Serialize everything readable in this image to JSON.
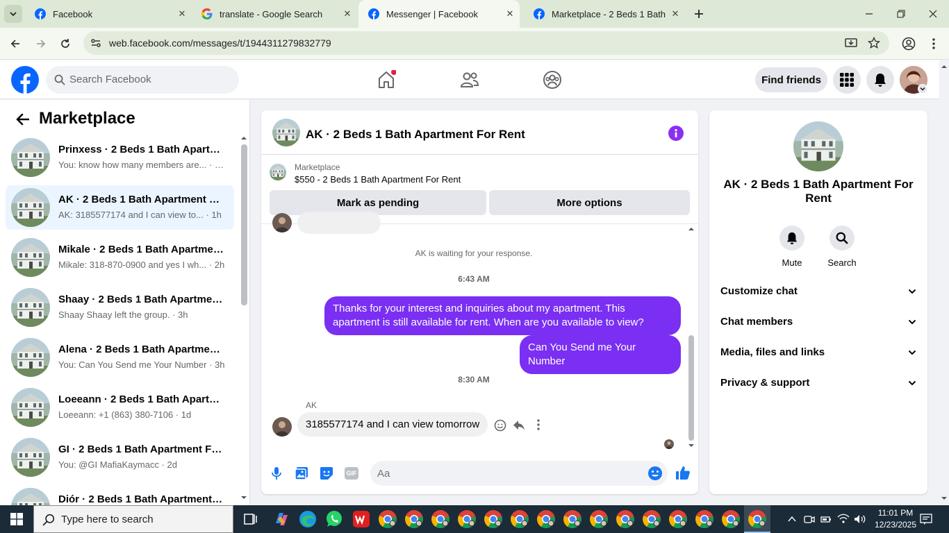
{
  "browser": {
    "tabs": [
      {
        "title": "Facebook",
        "icon": "facebook-icon",
        "active": false
      },
      {
        "title": "translate - Google Search",
        "icon": "google-icon",
        "active": false
      },
      {
        "title": "Messenger | Facebook",
        "icon": "facebook-icon",
        "active": true
      },
      {
        "title": "Marketplace - 2 Beds 1 Bath Ap",
        "icon": "facebook-icon",
        "active": false
      }
    ],
    "url": "web.facebook.com/messages/t/1944311279832779"
  },
  "fb_header": {
    "search_placeholder": "Search Facebook",
    "find_friends": "Find friends"
  },
  "sidebar": {
    "title": "Marketplace",
    "chats": [
      {
        "name": "Prinxess · 2 Beds 1 Bath Apartm...",
        "preview": "You: know how many members are... · 2m",
        "active": false
      },
      {
        "name": "AK · 2 Beds 1 Bath Apartment Fo...",
        "preview": "AK: 3185577174 and I can view to...  · 1h",
        "active": true
      },
      {
        "name": "Mikale · 2 Beds 1 Bath Apartmen...",
        "preview": "Mikale: 318-870-0900 and yes I wh... · 2h",
        "active": false
      },
      {
        "name": "Shaay · 2 Beds 1 Bath Apartment...",
        "preview": "Shaay Shaay left the group. · 3h",
        "active": false
      },
      {
        "name": "Alena · 2 Beds 1 Bath Apartment...",
        "preview": "You: Can You Send me Your Number · 3h",
        "active": false
      },
      {
        "name": "Loeeann · 2 Beds 1 Bath Apartm...",
        "preview": "Loeeann: +1 (863) 380-7106 · 1d",
        "active": false
      },
      {
        "name": "GI · 2 Beds 1 Bath Apartment Fo...",
        "preview": "You: @GI MafiaKaymacc · 2d",
        "active": false
      },
      {
        "name": "Diór · 2 Beds 1 Bath Apartment F...",
        "preview": "",
        "active": false
      }
    ]
  },
  "conversation": {
    "title": "AK · 2 Beds 1 Bath Apartment For Rent",
    "marketplace_label": "Marketplace",
    "listing": "$550 - 2 Beds 1 Bath Apartment For Rent",
    "mark_pending": "Mark as pending",
    "more_options": "More options",
    "waiting_text": "AK is waiting for your response.",
    "time1": "6:43 AM",
    "msg_out_1": "Thanks for your interest and inquiries about my apartment. This apartment is still available for rent. When are you available to view?",
    "msg_out_2": "Can You Send me Your Number",
    "time2": "8:30 AM",
    "sender": "AK",
    "msg_in_1": "3185577174 and I can view tomorrow",
    "input_placeholder": "Aa"
  },
  "details": {
    "title": "AK · 2 Beds 1 Bath Apartment For Rent",
    "mute": "Mute",
    "search": "Search",
    "sections": [
      "Customize chat",
      "Chat members",
      "Media, files and links",
      "Privacy & support"
    ]
  },
  "taskbar": {
    "search_placeholder": "Type here to search",
    "time": "11:01 PM",
    "date": "12/23/2025"
  },
  "colors": {
    "facebook_blue": "#0866ff",
    "message_purple": "#7a2ff3",
    "active_chat_bg": "#ebf5ff"
  }
}
